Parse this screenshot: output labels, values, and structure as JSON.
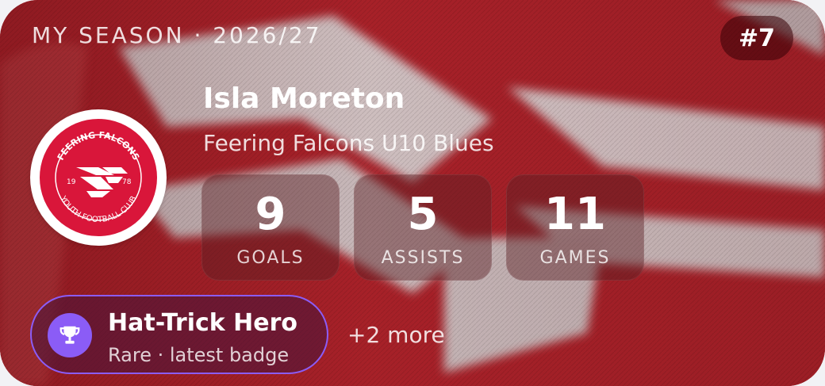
{
  "header": {
    "season_label": "MY SEASON · 2026/27",
    "rank": "#7"
  },
  "player": {
    "name": "Isla Moreton",
    "team": "Feering Falcons U10 Blues"
  },
  "crest": {
    "top_text": "FEERING FALCONS",
    "bottom_text": "YOUTH FOOTBALL CLUB",
    "year_left": "19",
    "year_right": "78",
    "color": "#d9163a"
  },
  "stats": [
    {
      "value": "9",
      "label": "GOALS"
    },
    {
      "value": "5",
      "label": "ASSISTS"
    },
    {
      "value": "11",
      "label": "GAMES"
    }
  ],
  "badge": {
    "title": "Hat-Trick Hero",
    "subtitle": "Rare · latest badge",
    "icon": "trophy-icon",
    "accent": "#8b5cf6"
  },
  "more_badges": "+2 more",
  "colors": {
    "card_red": "#b3242c",
    "emblem_white": "#ececec"
  }
}
